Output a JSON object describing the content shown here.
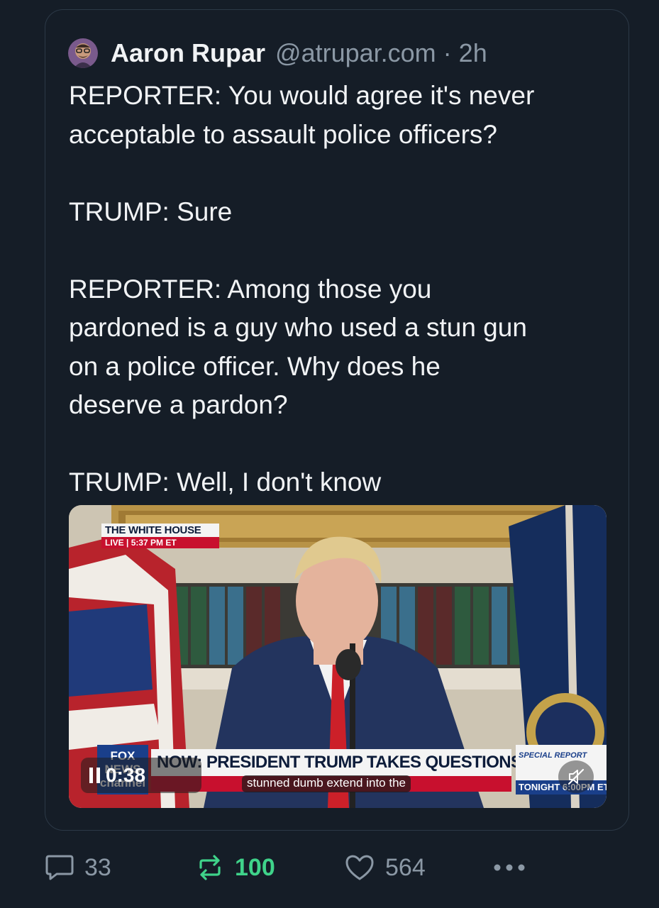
{
  "post": {
    "author_name": "Aaron Rupar",
    "handle": "@atrupar.com",
    "separator": "·",
    "time": "2h",
    "text": "REPORTER: You would agree it's never\nacceptable to assault police officers?\n\nTRUMP: Sure\n\nREPORTER: Among those you\npardoned is a guy who used a stun gun\non a police officer. Why does he\ndeserve a pardon?\n\nTRUMP: Well, I don't know"
  },
  "video": {
    "live_badge_title": "THE WHITE HOUSE",
    "live_badge_status": "LIVE  |  5:37 PM ET",
    "network_logo": "FOX NEWS channel",
    "headline": "NOW: PRESIDENT TRUMP TAKES QUESTIONS",
    "special_report": "SPECIAL REPORT",
    "special_time": "TONIGHT 6:00PM ET",
    "duration": "0:38",
    "caption": "stunned dumb extend into the",
    "playing": true,
    "muted": true
  },
  "actions": {
    "replies": "33",
    "reposts": "100",
    "likes": "564",
    "repost_active": true
  },
  "colors": {
    "background": "#151d27",
    "text_primary": "#f1f3f5",
    "text_secondary": "#8b98a5",
    "repost_active": "#3fd38a",
    "card_border": "#2c3947"
  },
  "icons": {
    "reply": "speech-bubble-icon",
    "repost": "repost-arrows-icon",
    "like": "heart-icon",
    "more": "ellipsis-icon",
    "pause": "pause-icon",
    "mute": "speaker-muted-icon"
  }
}
